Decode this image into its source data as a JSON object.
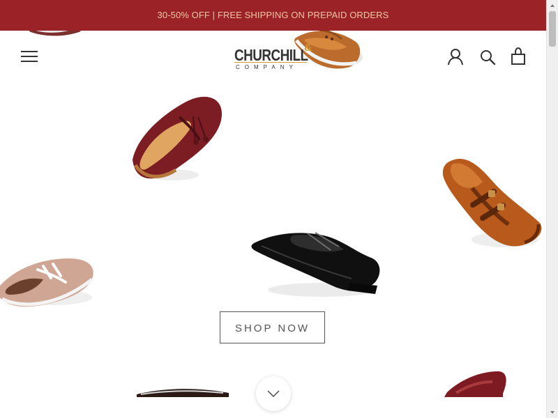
{
  "announcement": {
    "text": "30-50% OFF | FREE SHIPPING ON PREPAID ORDERS"
  },
  "header": {
    "logo": {
      "main": "CHURCHILL",
      "ampersand": "&",
      "sub": "COMPANY"
    },
    "icons": {
      "menu": "hamburger-menu-icon",
      "account": "user-account-icon",
      "search": "search-icon",
      "cart": "shopping-bag-icon"
    }
  },
  "hero": {
    "button_label": "SHOP NOW",
    "scroll_icon": "chevron-down-icon"
  },
  "colors": {
    "announcement_bg": "#9b2227",
    "announcement_text": "#f4c6a4",
    "logo_accent": "#d39a2f",
    "text_dark": "#333333"
  }
}
